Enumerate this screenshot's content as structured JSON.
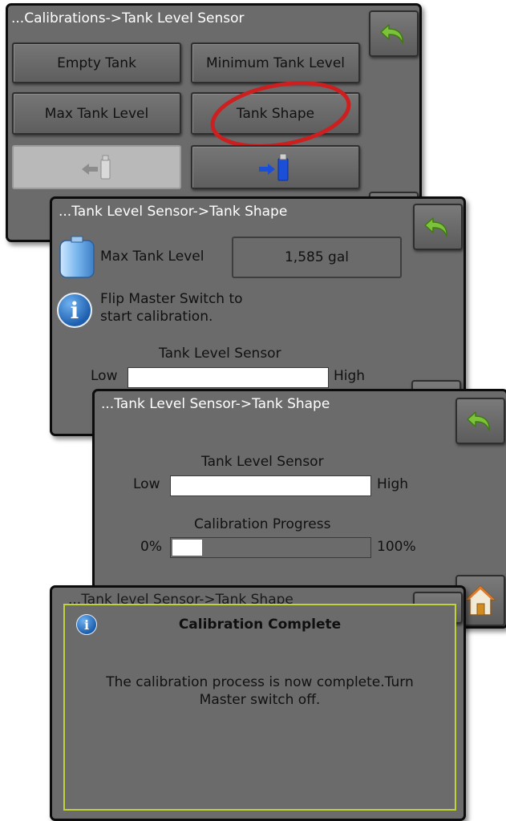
{
  "screen1": {
    "title": "...Calibrations->Tank Level Sensor",
    "buttons": {
      "empty_tank": "Empty Tank",
      "minimum_tank_level": "Minimum Tank Level",
      "max_tank_level": "Max Tank Level",
      "tank_shape": "Tank Shape"
    },
    "highlight_color": "#cc1f1f"
  },
  "screen2": {
    "title": "...Tank Level Sensor->Tank Shape",
    "max_tank_level_label": "Max Tank Level",
    "max_tank_level_value": "1,585 gal",
    "instruction_line1": "Flip Master Switch to",
    "instruction_line2": "start calibration.",
    "sensor_label": "Tank Level Sensor",
    "low_label": "Low",
    "high_label": "High"
  },
  "screen3": {
    "title": "...Tank Level Sensor->Tank Shape",
    "sensor_label": "Tank Level Sensor",
    "low_label": "Low",
    "high_label": "High",
    "progress_label": "Calibration Progress",
    "progress_min_label": "0%",
    "progress_max_label": "100%",
    "progress_fraction": 0.15
  },
  "screen4": {
    "title": "...Tank level Sensor->Tank Shape",
    "dialog_title": "Calibration Complete",
    "dialog_message_line1": "The calibration process is now complete.Turn",
    "dialog_message_line2": "Master switch off."
  },
  "icons": {
    "back": "back-arrow-icon",
    "home": "home-icon",
    "usb_import": "usb-import-icon",
    "usb_export": "usb-export-icon",
    "tank": "tank-icon",
    "info": "info-icon"
  },
  "colors": {
    "screen_bg": "#6b6b6b",
    "back_arrow": "#7cc23a",
    "dialog_border": "#c2d23a",
    "usb_blue": "#1b4fd8"
  }
}
